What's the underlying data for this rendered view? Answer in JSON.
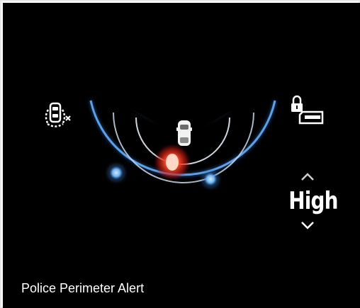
{
  "caption": "Police Perimeter Alert",
  "sensitivity": {
    "value": "High",
    "increase_icon": "chevron-up-icon",
    "decrease_icon": "chevron-down-icon"
  },
  "icons": {
    "left": "vehicle-proximity-icon",
    "right": "lock-door-icon"
  },
  "colors": {
    "screen_background": "#000000",
    "radar_ring": "#4a8fe0",
    "inner_ring": "#d9e6f5",
    "detection_marker": "#6fb4f0",
    "alert_marker": "#ff3b1f",
    "text": "#ffffff"
  }
}
